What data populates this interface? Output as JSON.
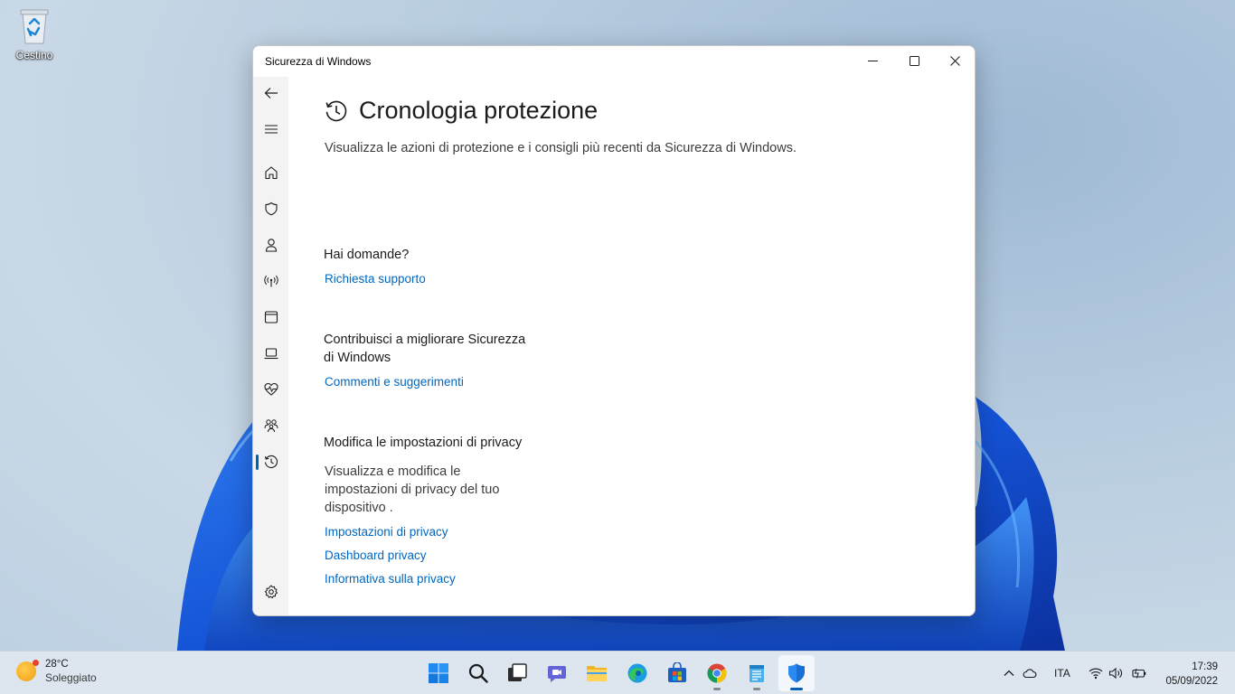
{
  "desktop": {
    "recycle_bin_label": "Cestino"
  },
  "window": {
    "title": "Sicurezza di Windows",
    "controls": {
      "minimize": "minimize-icon",
      "maximize": "maximize-icon",
      "close": "close-icon"
    }
  },
  "sidebar": {
    "items": [
      {
        "name": "back",
        "icon": "back-arrow-icon"
      },
      {
        "name": "menu",
        "icon": "hamburger-icon"
      },
      {
        "name": "home",
        "icon": "home-icon"
      },
      {
        "name": "virus-protection",
        "icon": "shield-icon"
      },
      {
        "name": "account-protection",
        "icon": "person-icon"
      },
      {
        "name": "firewall-network",
        "icon": "antenna-icon"
      },
      {
        "name": "app-browser-control",
        "icon": "app-window-icon"
      },
      {
        "name": "device-security",
        "icon": "laptop-icon"
      },
      {
        "name": "device-health",
        "icon": "heart-pulse-icon"
      },
      {
        "name": "family-options",
        "icon": "family-icon"
      },
      {
        "name": "protection-history",
        "icon": "history-icon",
        "active": true
      },
      {
        "name": "settings",
        "icon": "gear-icon"
      }
    ]
  },
  "page": {
    "title": "Cronologia protezione",
    "description": "Visualizza le azioni di protezione e i consigli più recenti da Sicurezza di Windows.",
    "sections": {
      "questions": {
        "title": "Hai domande?",
        "link": "Richiesta supporto"
      },
      "contribute": {
        "title": "Contribuisci a migliorare Sicurezza di Windows",
        "link": "Commenti e suggerimenti"
      },
      "privacy": {
        "title": "Modifica le impostazioni di privacy",
        "text": "Visualizza e modifica le impostazioni di privacy del tuo dispositivo .",
        "links": [
          "Impostazioni di privacy",
          "Dashboard privacy",
          "Informativa sulla privacy"
        ]
      }
    }
  },
  "taskbar": {
    "weather": {
      "temp": "28°C",
      "condition": "Soleggiato"
    },
    "apps": [
      "start-icon",
      "search-icon",
      "task-view-icon",
      "teams-chat-icon",
      "file-explorer-icon",
      "edge-icon",
      "store-icon",
      "chrome-icon",
      "notepad-icon",
      "windows-security-icon"
    ],
    "tray": {
      "language": "ITA",
      "time": "17:39",
      "date": "05/09/2022"
    }
  },
  "colors": {
    "accent": "#005fb8",
    "link": "#0067c0"
  }
}
